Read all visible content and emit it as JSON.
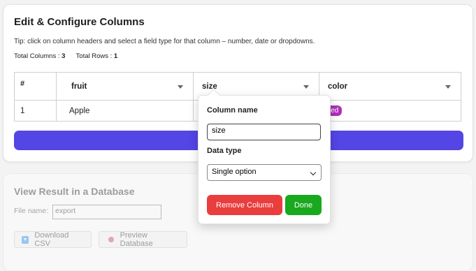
{
  "editor": {
    "title": "Edit & Configure Columns",
    "tip": "Tip: click on column headers and select a field type for that column – number, date or dropdowns.",
    "total_columns_label": "Total Columns :",
    "total_columns": "3",
    "total_rows_label": "Total Rows :",
    "total_rows": "1"
  },
  "table": {
    "headers": [
      "#",
      "fruit",
      "size",
      "color"
    ],
    "rows": [
      {
        "num": "1",
        "fruit": "Apple",
        "size": "",
        "color": "Red"
      }
    ],
    "badge_color": "#b02fb8"
  },
  "apply_bar_color": "#5445e5",
  "popup": {
    "column_name_label": "Column name",
    "column_name_value": "size",
    "data_type_label": "Data type",
    "data_type_value": "Single option",
    "remove_label": "Remove Column",
    "done_label": "Done",
    "remove_color": "#ea3d3d",
    "done_color": "#19a81e"
  },
  "view": {
    "title": "View Result in a Database",
    "file_name_label": "File name:",
    "file_name_value": "export",
    "download_label": "Download CSV",
    "preview_label": "Preview Database",
    "download_icon": "download-icon",
    "preview_icon": "database-icon"
  }
}
